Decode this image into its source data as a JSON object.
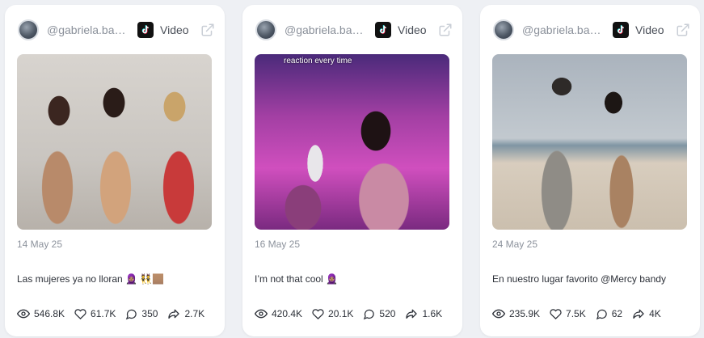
{
  "cards": [
    {
      "username": "@gabriela.ban...",
      "platform": "Video",
      "media_overlay_text": "",
      "date": "14 May 25",
      "caption": "Las mujeres ya no lloran 🧕🏽 👯🏽",
      "stats": {
        "views": "546.8K",
        "likes": "61.7K",
        "comments": "350",
        "shares": "2.7K"
      }
    },
    {
      "username": "@gabriela.ban...",
      "platform": "Video",
      "media_overlay_text": "reaction every time",
      "date": "16 May 25",
      "caption": "I’m not that cool 🧕🏽",
      "stats": {
        "views": "420.4K",
        "likes": "20.1K",
        "comments": "520",
        "shares": "1.6K"
      }
    },
    {
      "username": "@gabriela.ban...",
      "platform": "Video",
      "media_overlay_text": "",
      "date": "24 May 25",
      "caption": "En nuestro lugar favorito @Mercy bandy",
      "stats": {
        "views": "235.9K",
        "likes": "7.5K",
        "comments": "62",
        "shares": "4K"
      }
    }
  ],
  "icons": {
    "platform": "tiktok-icon",
    "open": "external-link-icon",
    "views": "eye-icon",
    "likes": "heart-icon",
    "comments": "comment-icon",
    "shares": "share-icon"
  },
  "colors": {
    "background": "#eef0f4",
    "card": "#ffffff",
    "muted_text": "#8a909a",
    "body_text": "#2c3038"
  }
}
